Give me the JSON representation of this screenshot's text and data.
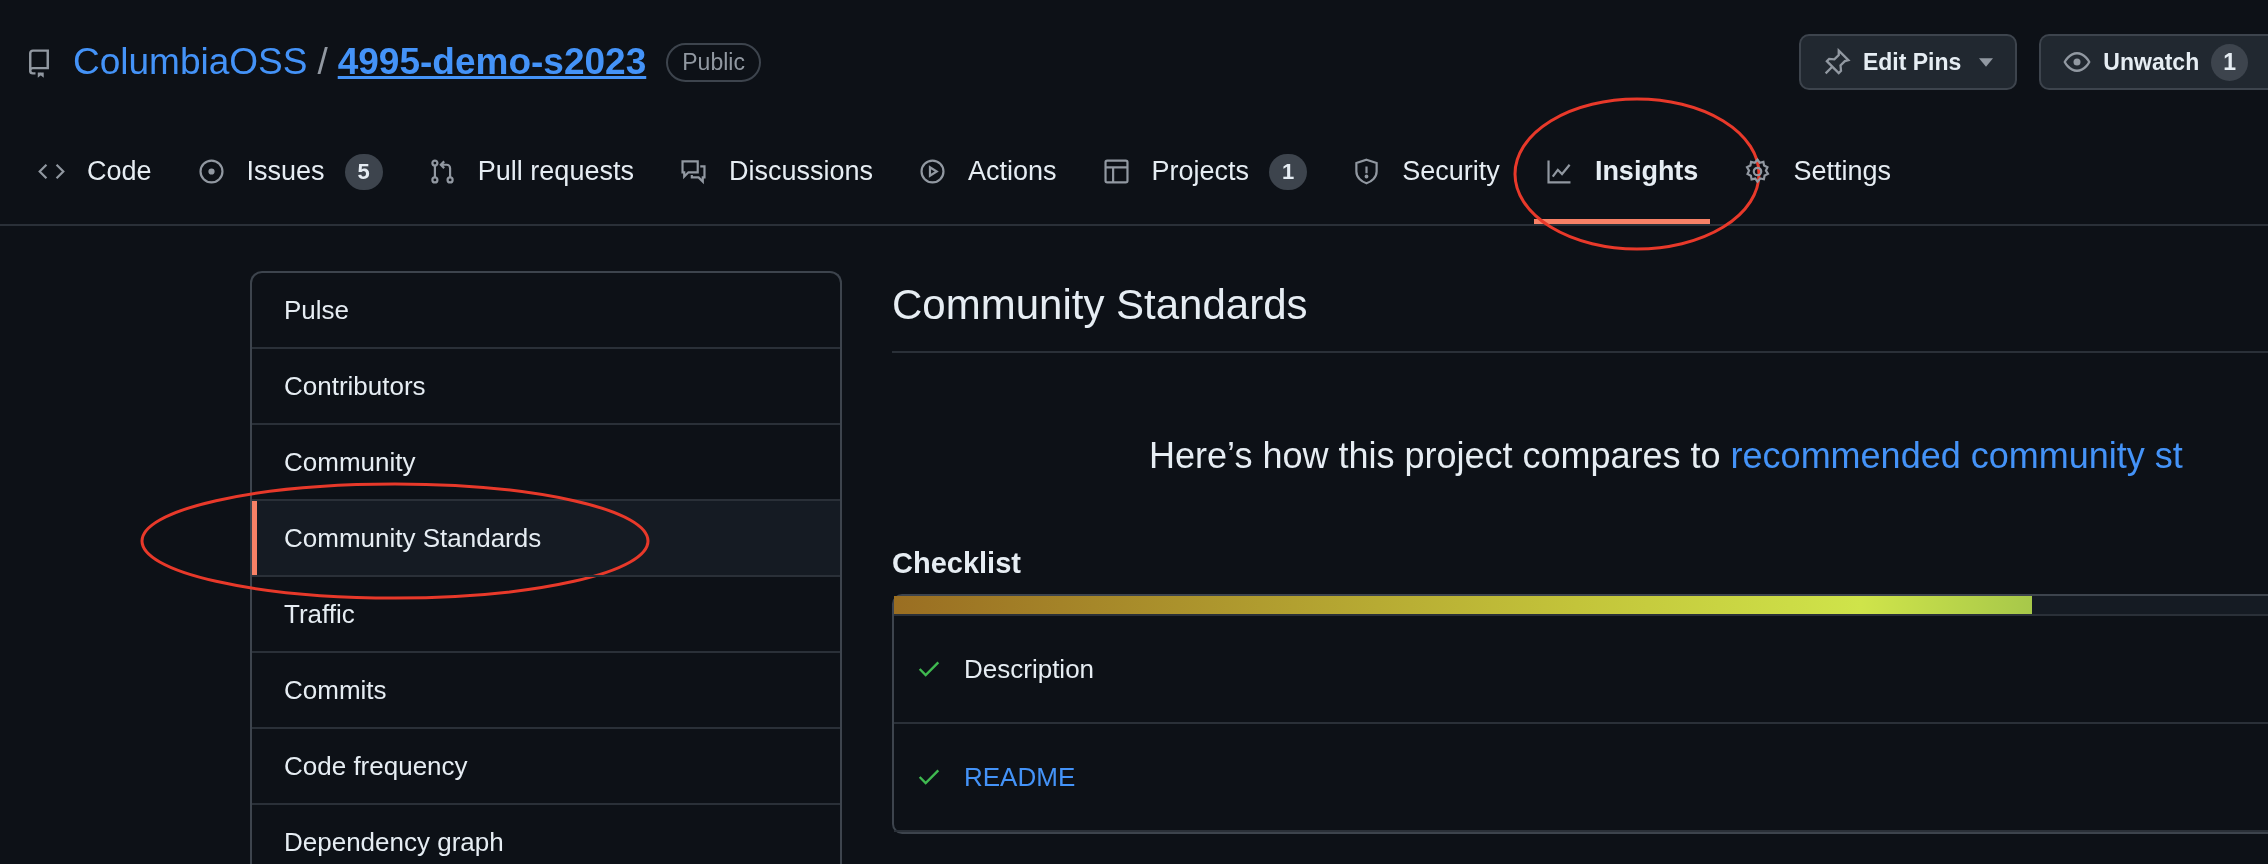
{
  "repo": {
    "owner": "ColumbiaOSS",
    "separator": "/",
    "name": "4995-demo-s2023",
    "visibility": "Public"
  },
  "actions": [
    {
      "kind": "pin",
      "label": "Edit Pins"
    },
    {
      "kind": "watch",
      "label": "Unwatch",
      "count": "1"
    }
  ],
  "tabs": [
    {
      "label": "Code",
      "selected": false,
      "circled": false
    },
    {
      "label": "Issues",
      "count": "5",
      "selected": false,
      "circled": false
    },
    {
      "label": "Pull requests",
      "selected": false,
      "circled": false
    },
    {
      "label": "Discussions",
      "selected": false,
      "circled": false
    },
    {
      "label": "Actions",
      "selected": false,
      "circled": false
    },
    {
      "label": "Projects",
      "count": "1",
      "selected": false,
      "circled": false
    },
    {
      "label": "Security",
      "selected": false,
      "circled": false
    },
    {
      "label": "Insights",
      "selected": true,
      "circled": true
    },
    {
      "label": "Settings",
      "selected": false,
      "circled": false
    }
  ],
  "sidebar": {
    "items": [
      {
        "label": "Pulse",
        "selected": false,
        "circled": false
      },
      {
        "label": "Contributors",
        "selected": false,
        "circled": false
      },
      {
        "label": "Community",
        "selected": false,
        "circled": false
      },
      {
        "label": "Community Standards",
        "selected": true,
        "circled": true
      },
      {
        "label": "Traffic",
        "selected": false,
        "circled": false
      },
      {
        "label": "Commits",
        "selected": false,
        "circled": false
      },
      {
        "label": "Code frequency",
        "selected": false,
        "circled": false
      },
      {
        "label": "Dependency graph",
        "selected": false,
        "circled": false
      }
    ]
  },
  "main": {
    "title": "Community Standards",
    "intro": "Here’s how this project compares to",
    "intro_link": "recommended community st",
    "checklist_title": "Checklist",
    "progress": {
      "level": 0.805
    },
    "checklist": [
      {
        "label": "Description",
        "done": true,
        "link": false
      },
      {
        "label": "README",
        "done": true,
        "link": true
      }
    ]
  }
}
